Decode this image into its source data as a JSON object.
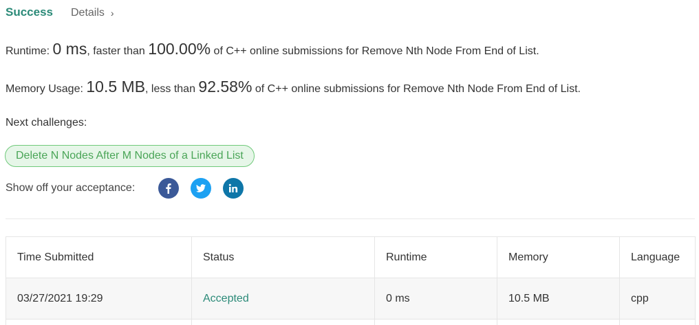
{
  "header": {
    "success_label": "Success",
    "details_label": "Details",
    "details_chevron": "›"
  },
  "runtime": {
    "label": "Runtime:",
    "value": "0 ms",
    "middle": ", faster than",
    "percent": "100.00%",
    "tail": "of C++ online submissions for Remove Nth Node From End of List."
  },
  "memory": {
    "label": "Memory Usage:",
    "value": "10.5 MB",
    "middle": ", less than",
    "percent": "92.58%",
    "tail": "of C++ online submissions for Remove Nth Node From End of List."
  },
  "next": {
    "label": "Next challenges:",
    "challenges": [
      "Delete N Nodes After M Nodes of a Linked List"
    ]
  },
  "share": {
    "label": "Show off your acceptance:",
    "icons": [
      "facebook-icon",
      "twitter-icon",
      "linkedin-icon"
    ]
  },
  "colors": {
    "success": "#2b8a78",
    "facebook": "#3b5998",
    "twitter": "#1da1f2",
    "linkedin": "#0e76a8",
    "challenge_border": "#6fc97a",
    "challenge_bg": "#e6f6e8"
  },
  "table": {
    "headers": [
      "Time Submitted",
      "Status",
      "Runtime",
      "Memory",
      "Language"
    ],
    "rows": [
      [
        "03/27/2021 19:29",
        "Accepted",
        "0 ms",
        "10.5 MB",
        "cpp"
      ]
    ]
  }
}
